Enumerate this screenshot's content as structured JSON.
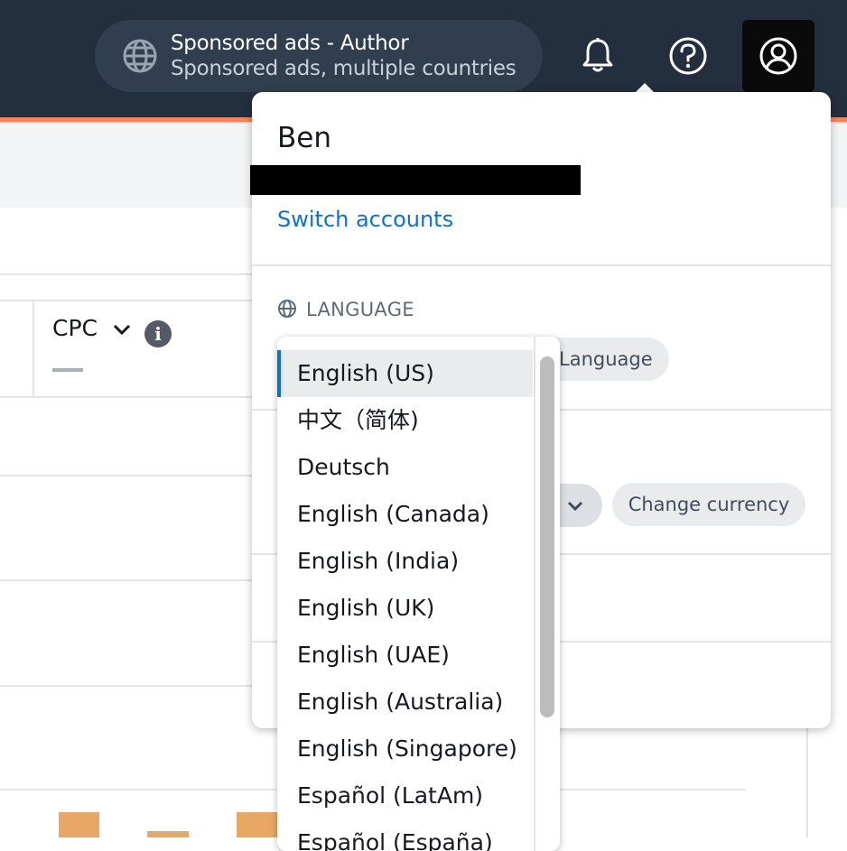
{
  "header": {
    "account_title": "Sponsored ads - Author",
    "account_subtitle": "Sponsored ads, multiple countries",
    "icons": [
      "globe-icon",
      "bell-icon",
      "help-icon",
      "user-circle-icon"
    ]
  },
  "background": {
    "column_header": "CPC",
    "column_value": "—"
  },
  "account_menu": {
    "user_name": "Ben",
    "switch_accounts_label": "Switch accounts",
    "language_heading": "LANGUAGE",
    "language_button_label": "Language",
    "currency_button_label": "Change currency"
  },
  "language_dropdown": {
    "options": [
      "English (US)",
      "中文（简体)",
      "Deutsch",
      "English (Canada)",
      "English (India)",
      "English (UK)",
      "English (UAE)",
      "English (Australia)",
      "English (Singapore)",
      "Español (LatAm)",
      "Español (España)"
    ],
    "selected": "English (US)"
  },
  "colors": {
    "topbar": "#232f3e",
    "accent": "#ff7f50",
    "link": "#0972d3",
    "bar": "#e8a765"
  }
}
